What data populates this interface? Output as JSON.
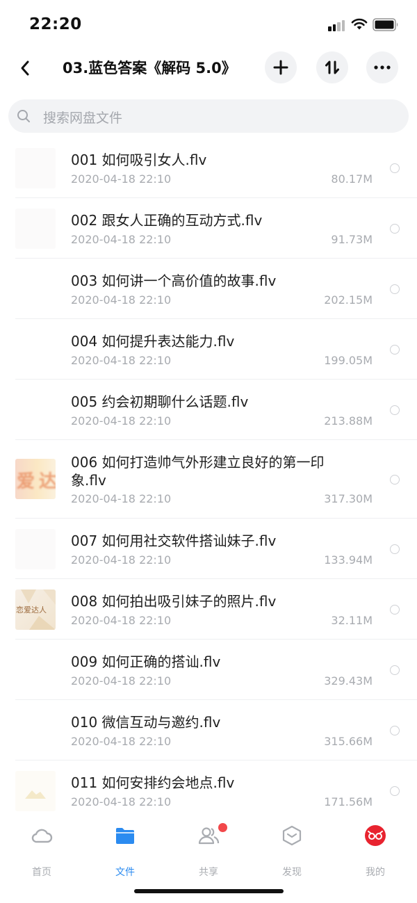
{
  "status_bar": {
    "time": "22:20"
  },
  "header": {
    "title": "03.蓝色答案《解码 5.0》",
    "back_icon": "chevron-left-icon",
    "add_icon": "plus-icon",
    "sort_icon": "sort-icon",
    "more_icon": "more-horizontal-icon"
  },
  "search": {
    "placeholder": "搜索网盘文件"
  },
  "files": [
    {
      "name": "001 如何吸引女人.flv",
      "date": "2020-04-18 22:10",
      "size": "80.17M",
      "thumb": "blank"
    },
    {
      "name": "002 跟女人正确的互动方式.flv",
      "date": "2020-04-18 22:10",
      "size": "91.73M",
      "thumb": "blank"
    },
    {
      "name": "003 如何讲一个高价值的故事.flv",
      "date": "2020-04-18 22:10",
      "size": "202.15M",
      "thumb": "none"
    },
    {
      "name": "004 如何提升表达能力.flv",
      "date": "2020-04-18 22:10",
      "size": "199.05M",
      "thumb": "none"
    },
    {
      "name": "005 约会初期聊什么话题.flv",
      "date": "2020-04-18 22:10",
      "size": "213.88M",
      "thumb": "none"
    },
    {
      "name": "006 如何打造帅气外形建立良好的第一印象.flv",
      "date": "2020-04-18 22:10",
      "size": "317.30M",
      "thumb": "orange"
    },
    {
      "name": "007 如何用社交软件搭讪妹子.flv",
      "date": "2020-04-18 22:10",
      "size": "133.94M",
      "thumb": "blank"
    },
    {
      "name": "008 如何拍出吸引妹子的照片.flv",
      "date": "2020-04-18 22:10",
      "size": "32.11M",
      "thumb": "beige"
    },
    {
      "name": "009 如何正确的搭讪.flv",
      "date": "2020-04-18 22:10",
      "size": "329.43M",
      "thumb": "none"
    },
    {
      "name": "010 微信互动与邀约.flv",
      "date": "2020-04-18 22:10",
      "size": "315.66M",
      "thumb": "none"
    },
    {
      "name": "011 如何安排约会地点.flv",
      "date": "2020-04-18 22:10",
      "size": "171.56M",
      "thumb": "faint"
    }
  ],
  "tabs": [
    {
      "label": "首页",
      "icon": "cloud-icon",
      "active": false
    },
    {
      "label": "文件",
      "icon": "folder-icon",
      "active": true
    },
    {
      "label": "共享",
      "icon": "users-icon",
      "active": false,
      "badge": true
    },
    {
      "label": "发现",
      "icon": "discover-box-icon",
      "active": false
    },
    {
      "label": "我的",
      "icon": "profile-avatar-icon",
      "active": false
    }
  ],
  "colors": {
    "accent": "#2b8bf0",
    "badge": "#f2474a",
    "avatar": "#e8232f",
    "muted_text": "#a8abb0"
  },
  "thumb_text": {
    "orange": "爱达",
    "beige": "恋爱达人"
  }
}
